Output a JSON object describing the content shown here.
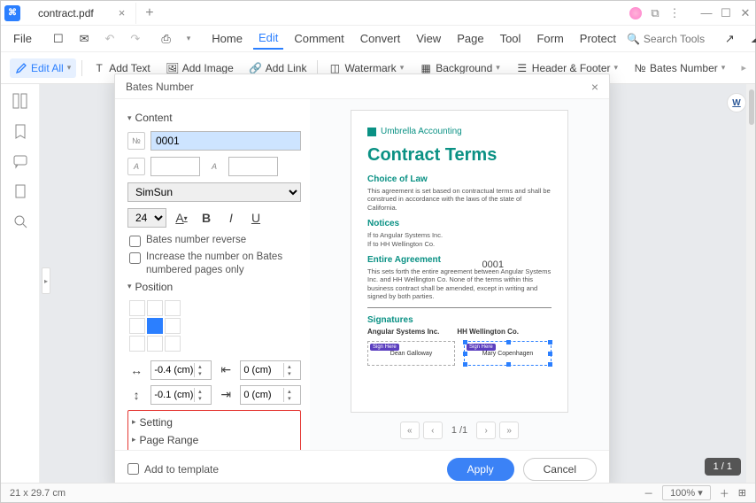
{
  "titlebar": {
    "filename": "contract.pdf"
  },
  "menu": {
    "file": "File",
    "home": "Home",
    "edit": "Edit",
    "comment": "Comment",
    "convert": "Convert",
    "view": "View",
    "page": "Page",
    "tool": "Tool",
    "form": "Form",
    "protect": "Protect",
    "search_ph": "Search Tools"
  },
  "toolbar": {
    "edit_all": "Edit All",
    "add_text": "Add Text",
    "add_image": "Add Image",
    "add_link": "Add Link",
    "watermark": "Watermark",
    "background": "Background",
    "header_footer": "Header & Footer",
    "bates_number": "Bates Number"
  },
  "dialog": {
    "title": "Bates Number",
    "content_label": "Content",
    "number_value": "0001",
    "font_name": "SimSun",
    "font_size": "24",
    "reverse_label": "Bates number reverse",
    "increase_label": "Increase the number on Bates numbered pages only",
    "position_label": "Position",
    "offset1": "-0.4 (cm)",
    "offset2": "0 (cm)",
    "offset3": "-0.1 (cm)",
    "offset4": "0 (cm)",
    "setting_label": "Setting",
    "page_range_label": "Page Range",
    "add_to_template": "Add to template",
    "apply": "Apply",
    "cancel": "Cancel",
    "pager": "1 /1"
  },
  "preview": {
    "company": "Umbrella Accounting",
    "title": "Contract Terms",
    "h1": "Choice of Law",
    "t1": "This agreement is set based on contractual terms and shall be construed in accordance with the laws of the state of California.",
    "h2": "Notices",
    "t2a": "If to Angular Systems Inc.",
    "t2b": "If to HH Wellington Co.",
    "h3": "Entire Agreement",
    "t3": "This sets forth the entire agreement between Angular Systems Inc. and HH Wellington Co. None of the terms within this business contract shall be amended, except in writing and signed by both parties.",
    "h4": "Signatures",
    "party1": "Angular Systems Inc.",
    "party2": "HH Wellington Co.",
    "sig1": "Dean Galloway",
    "sig2": "Mary Copenhagen",
    "sign_here": "Sign Here",
    "bn": "0001"
  },
  "status": {
    "dims": "21 x 29.7 cm",
    "zoom": "100%",
    "page": "1 / 1"
  },
  "rail": {
    "word": "W"
  }
}
